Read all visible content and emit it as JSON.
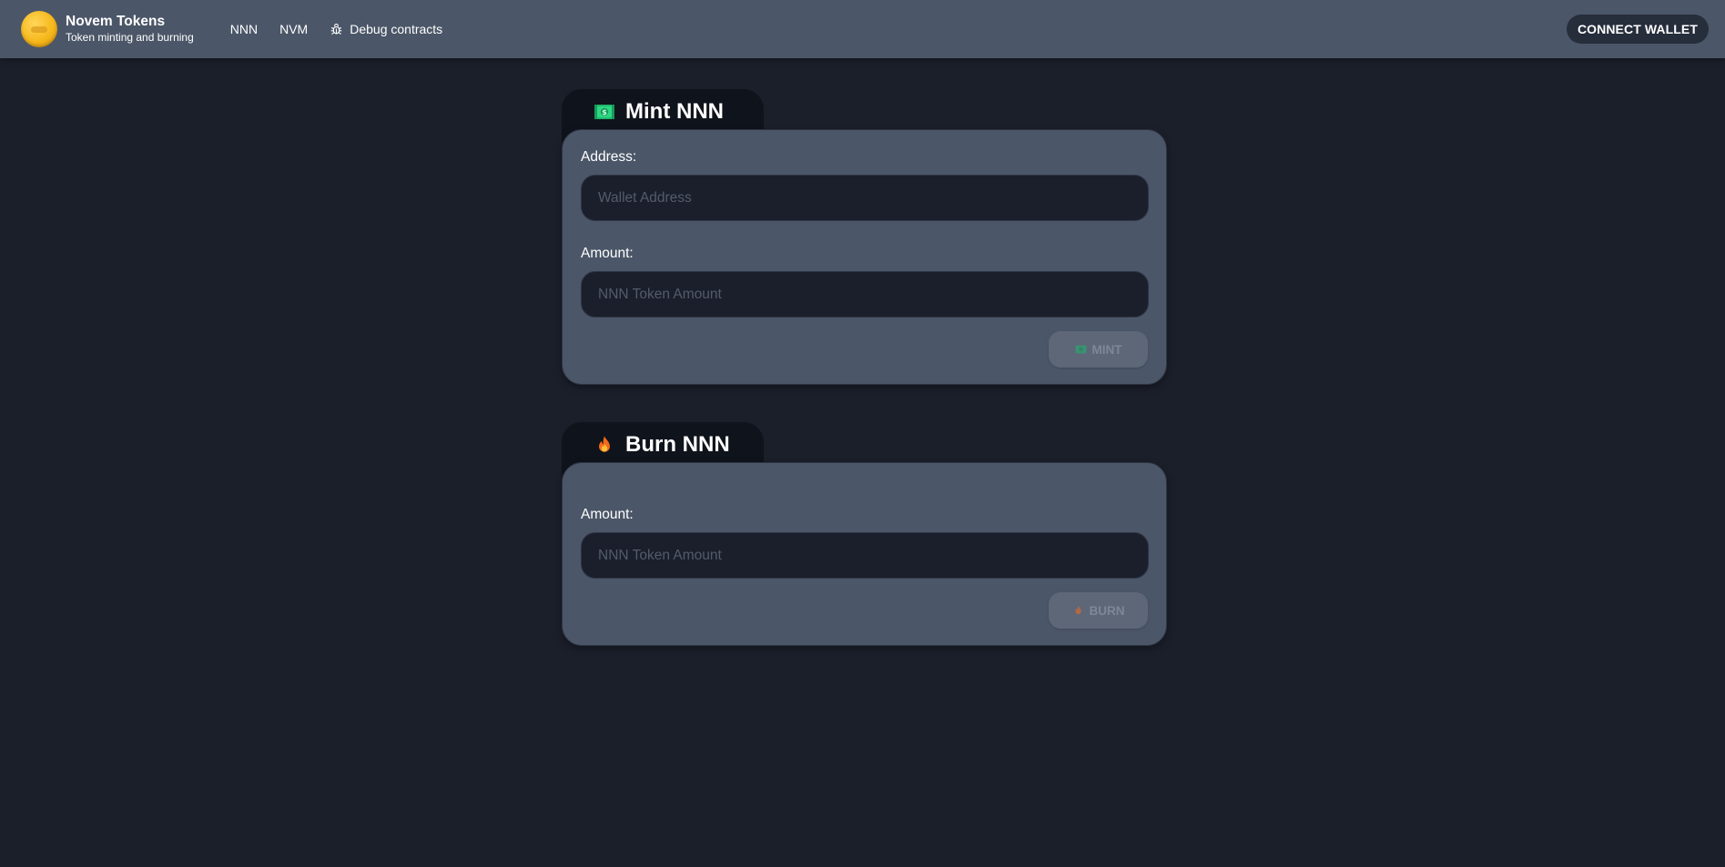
{
  "header": {
    "brand_title": "Novem Tokens",
    "brand_subtitle": "Token minting and burning",
    "nav": [
      {
        "label": "NNN"
      },
      {
        "label": "NVM"
      },
      {
        "label": "Debug contracts",
        "icon": "bug-icon"
      }
    ],
    "connect_label": "CONNECT WALLET"
  },
  "mint": {
    "title": "Mint NNN",
    "icon": "money-icon",
    "address_label": "Address:",
    "address_placeholder": "Wallet Address",
    "amount_label": "Amount:",
    "amount_placeholder": "NNN Token Amount",
    "button_label": "MINT",
    "button_disabled": true
  },
  "burn": {
    "title": "Burn NNN",
    "icon": "fire-icon",
    "amount_label": "Amount:",
    "amount_placeholder": "NNN Token Amount",
    "button_label": "BURN",
    "button_disabled": true
  },
  "colors": {
    "background": "#1b1f2a",
    "header": "#4b5668",
    "panel": "#4b5668",
    "tab": "#0f131b",
    "input": "#1b1f2b",
    "accent_gold": "#f6b81c"
  }
}
